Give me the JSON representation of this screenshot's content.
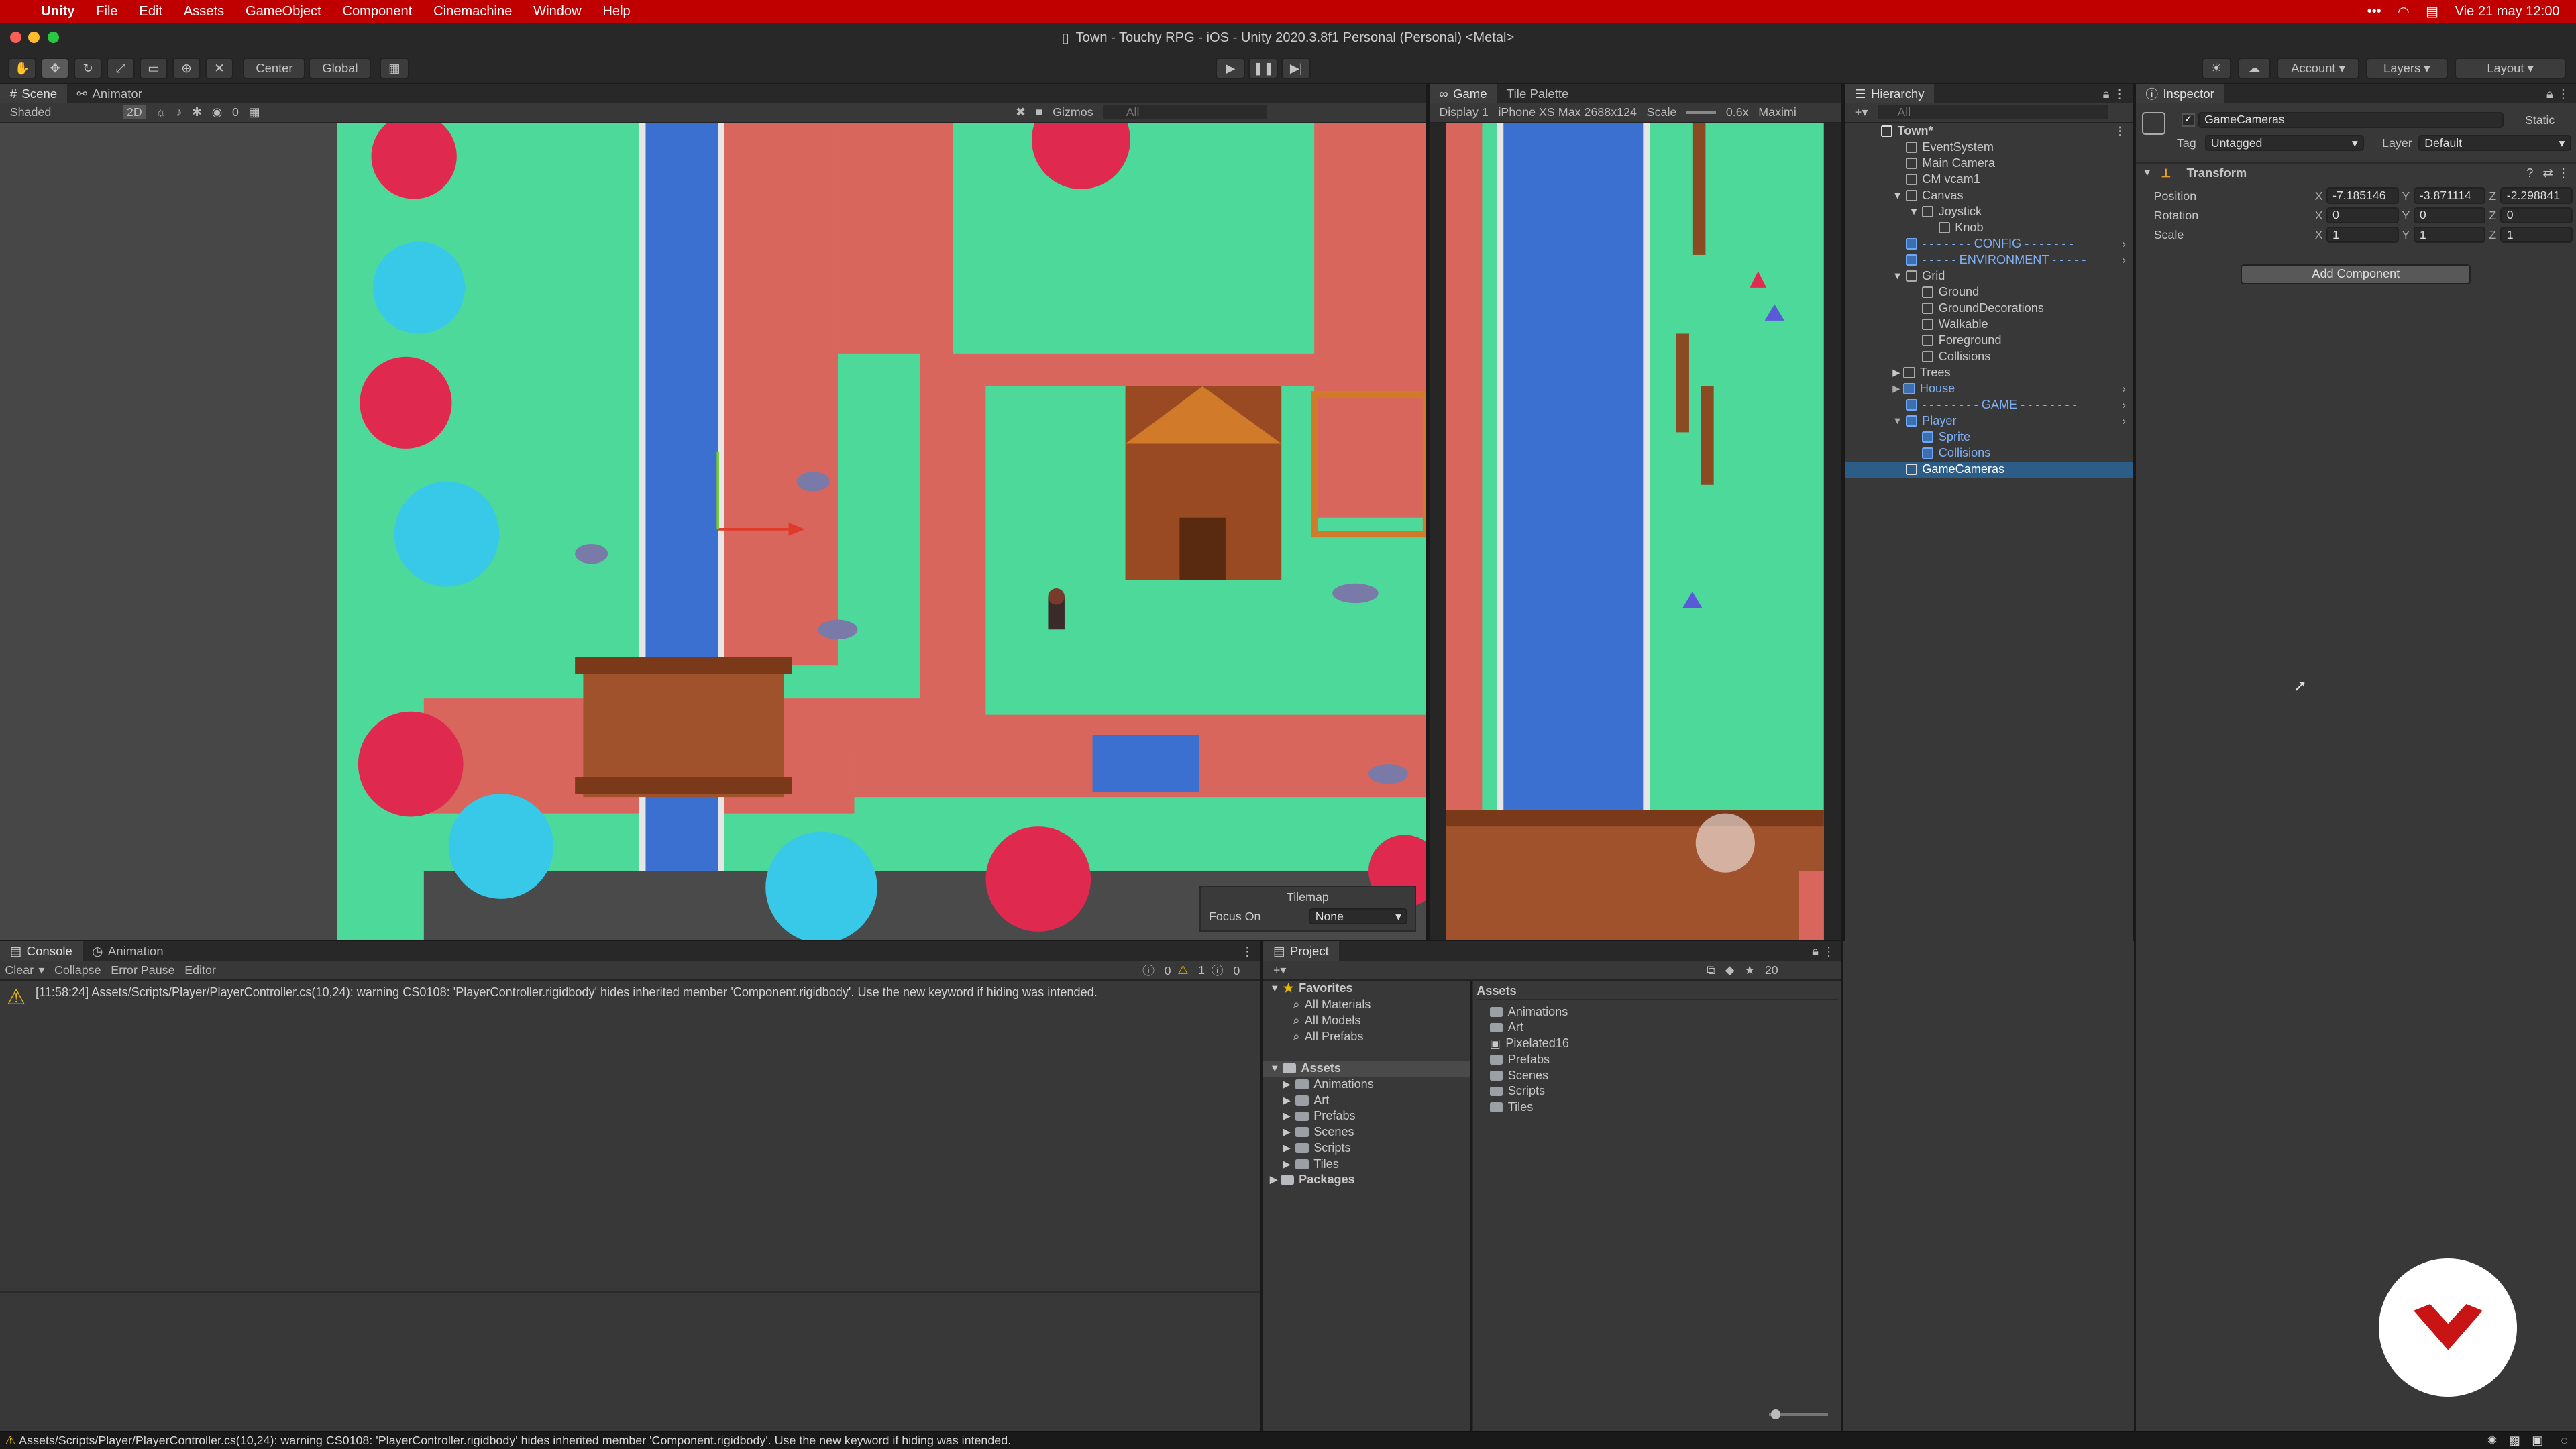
{
  "menubar": {
    "app": "Unity",
    "items": [
      "File",
      "Edit",
      "Assets",
      "GameObject",
      "Component",
      "Cinemachine",
      "Window",
      "Help"
    ],
    "clock": "Vie 21 may  12:00"
  },
  "window": {
    "title": "Town - Touchy RPG - iOS - Unity 2020.3.8f1 Personal (Personal) <Metal>"
  },
  "toolbar": {
    "pivot": "Center",
    "space": "Global",
    "account": "Account",
    "layers": "Layers",
    "layout": "Layout"
  },
  "scene": {
    "tabs": [
      "Scene",
      "Animator"
    ],
    "shading": "Shaded",
    "mode2d": "2D",
    "gizmos": "Gizmos",
    "search": "All",
    "hidden_count": "0",
    "tilemap": {
      "title": "Tilemap",
      "focus_label": "Focus On",
      "focus_value": "None"
    }
  },
  "game": {
    "tabs": [
      "Game",
      "Tile Palette"
    ],
    "display": "Display 1",
    "resolution": "iPhone XS Max 2688x124",
    "scale_label": "Scale",
    "scale_value": "0.6x",
    "maximize": "Maximi"
  },
  "hierarchy": {
    "tab": "Hierarchy",
    "search": "All",
    "items": [
      {
        "label": "Town*",
        "depth": 0,
        "style": "scene"
      },
      {
        "label": "EventSystem",
        "depth": 1
      },
      {
        "label": "Main Camera",
        "depth": 1
      },
      {
        "label": "CM vcam1",
        "depth": 1
      },
      {
        "label": "Canvas",
        "depth": 1
      },
      {
        "label": "Joystick",
        "depth": 2
      },
      {
        "label": "Knob",
        "depth": 3
      },
      {
        "label": "- - - - - - - CONFIG - - - - - - -",
        "depth": 1,
        "style": "blue"
      },
      {
        "label": "- - - - - ENVIRONMENT - - - - -",
        "depth": 1,
        "style": "blue"
      },
      {
        "label": "Grid",
        "depth": 1
      },
      {
        "label": "Ground",
        "depth": 2
      },
      {
        "label": "GroundDecorations",
        "depth": 2
      },
      {
        "label": "Walkable",
        "depth": 2
      },
      {
        "label": "Foreground",
        "depth": 2
      },
      {
        "label": "Collisions",
        "depth": 2
      },
      {
        "label": "Trees",
        "depth": 1
      },
      {
        "label": "House",
        "depth": 1,
        "style": "blue"
      },
      {
        "label": "- - - - - - - - GAME - - - - - - - -",
        "depth": 1,
        "style": "blue"
      },
      {
        "label": "Player",
        "depth": 1,
        "style": "blue"
      },
      {
        "label": "Sprite",
        "depth": 2,
        "style": "blue"
      },
      {
        "label": "Collisions",
        "depth": 2,
        "style": "blue"
      },
      {
        "label": "GameCameras",
        "depth": 1,
        "style": "sel"
      }
    ]
  },
  "inspector": {
    "tab": "Inspector",
    "object_name": "GameCameras",
    "static_label": "Static",
    "tag_label": "Tag",
    "tag_value": "Untagged",
    "layer_label": "Layer",
    "layer_value": "Default",
    "component": "Transform",
    "rows": [
      {
        "label": "Position",
        "x": "-7.185146",
        "y": "-3.871114",
        "z": "-2.298841"
      },
      {
        "label": "Rotation",
        "x": "0",
        "y": "0",
        "z": "0"
      },
      {
        "label": "Scale",
        "x": "1",
        "y": "1",
        "z": "1"
      }
    ],
    "add_component": "Add Component"
  },
  "console": {
    "tabs": [
      "Console",
      "Animation"
    ],
    "buttons": [
      "Clear",
      "Collapse",
      "Error Pause",
      "Editor"
    ],
    "counts": {
      "log": "0",
      "warn": "1",
      "error": "0"
    },
    "messages": [
      "[11:58:24] Assets/Scripts/Player/PlayerController.cs(10,24): warning CS0108: 'PlayerController.rigidbody' hides inherited member 'Component.rigidbody'. Use the new keyword if hiding was intended."
    ]
  },
  "project": {
    "tab": "Project",
    "hidden_count": "20",
    "favorites_label": "Favorites",
    "favorites": [
      "All Materials",
      "All Models",
      "All Prefabs"
    ],
    "assets_label": "Assets",
    "tree": [
      "Animations",
      "Art",
      "Prefabs",
      "Scenes",
      "Scripts",
      "Tiles"
    ],
    "packages_label": "Packages",
    "breadcrumb": "Assets",
    "grid": [
      "Animations",
      "Art",
      "Pixelated16",
      "Prefabs",
      "Scenes",
      "Scripts",
      "Tiles"
    ]
  },
  "status": {
    "message": "Assets/Scripts/Player/PlayerController.cs(10,24): warning CS0108: 'PlayerController.rigidbody' hides inherited member 'Component.rigidbody'. Use the new keyword if hiding was intended."
  },
  "colors": {
    "menubar": "#c00000",
    "grass": "#4cd99a",
    "path": "#d9665d",
    "water": "#3b6fd0",
    "selection": "#2c5d87",
    "logo": "#c81414"
  }
}
